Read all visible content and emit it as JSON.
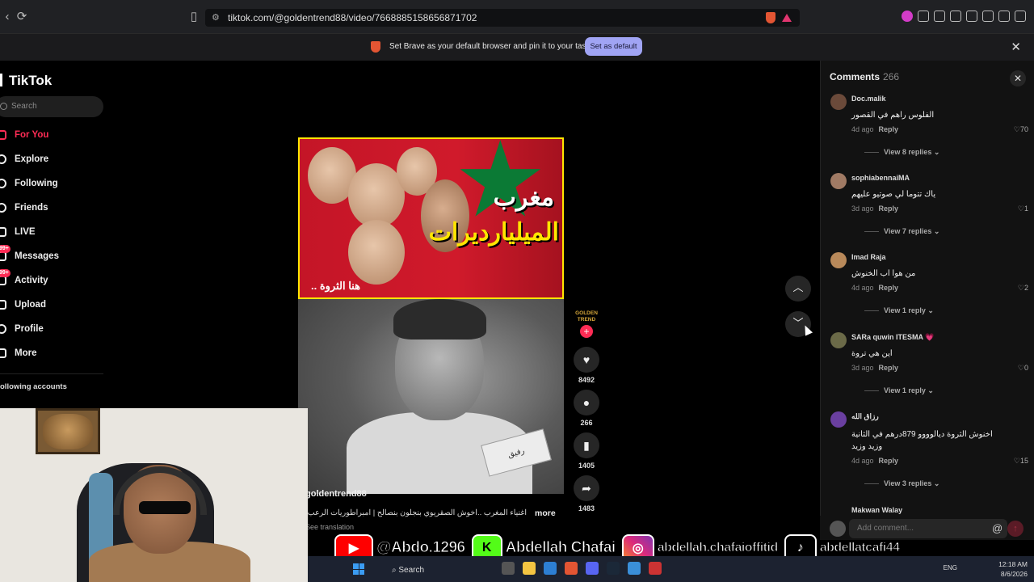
{
  "browser": {
    "url": "tiktok.com/@goldentrend88/video/7668885158656871702",
    "notification": "Set Brave as your default browser and pin it to your taskbar",
    "set_default_label": "Set as default"
  },
  "sidebar": {
    "logo": "TikTok",
    "search_placeholder": "Search",
    "items": [
      {
        "label": "For You",
        "icon": "home-icon",
        "active": true
      },
      {
        "label": "Explore",
        "icon": "compass-icon"
      },
      {
        "label": "Following",
        "icon": "following-icon"
      },
      {
        "label": "Friends",
        "icon": "friends-icon"
      },
      {
        "label": "LIVE",
        "icon": "live-icon"
      },
      {
        "label": "Messages",
        "icon": "messages-icon",
        "badge": "99+"
      },
      {
        "label": "Activity",
        "icon": "activity-icon",
        "badge": "99+"
      },
      {
        "label": "Upload",
        "icon": "upload-icon"
      },
      {
        "label": "Profile",
        "icon": "profile-icon"
      },
      {
        "label": "More",
        "icon": "more-icon"
      }
    ],
    "following_accounts": "ollowing accounts"
  },
  "video": {
    "thumbnail_title_line1": "مغرب",
    "thumbnail_title_line2": "الميليارديرات",
    "thumbnail_small": "هنا الثروة ..",
    "mic_label": "رفيق",
    "username": "goldentrend88",
    "caption": "اغنياء المغرب ..اخوش الصقريوي بنجلون بنصالح | امبراطوريات الرعب",
    "more_label": "more",
    "see_translation": "See translation",
    "creator_badge": "GOLDEN TREND",
    "likes": "8492",
    "comments": "266",
    "saves": "1405",
    "shares": "1483"
  },
  "comments_panel": {
    "title": "Comments",
    "count": "266",
    "input_placeholder": "Add comment...",
    "items": [
      {
        "name": "Doc.malik",
        "text": "الفلوس راهم في القصور",
        "time": "4d ago",
        "reply": "Reply",
        "likes": "70",
        "replies": "View 8 replies"
      },
      {
        "name": "sophiabennaiMA",
        "text": "ياك تتوما لي صوتيو عليهم",
        "time": "3d ago",
        "reply": "Reply",
        "likes": "1",
        "replies": "View 7 replies"
      },
      {
        "name": "Imad Raja",
        "text": "من هوا اب الخنوش",
        "time": "4d ago",
        "reply": "Reply",
        "likes": "2",
        "replies": "View 1 reply"
      },
      {
        "name": "SARa quwin ITESMA 💗",
        "text": "اين هي تروة",
        "time": "3d ago",
        "reply": "Reply",
        "likes": "0",
        "replies": "View 1 reply"
      },
      {
        "name": "رزاق الله",
        "text": "اخنوش الثروة ديالوووو 879درهم في الثانية وزيد وزيد",
        "time": "4d ago",
        "reply": "Reply",
        "likes": "15",
        "replies": "View 3 replies"
      }
    ],
    "partial_name": "Makwan Walay"
  },
  "social": {
    "youtube": "@Abdo.1296",
    "kick": "Abdellah Chafai",
    "instagram": "abdellah.chafaioffitid",
    "tiktok": "abdellatcafi44"
  },
  "taskbar": {
    "search": "Search",
    "lang": "ENG",
    "time": "12:18 AM",
    "date": "8/6/2026"
  }
}
